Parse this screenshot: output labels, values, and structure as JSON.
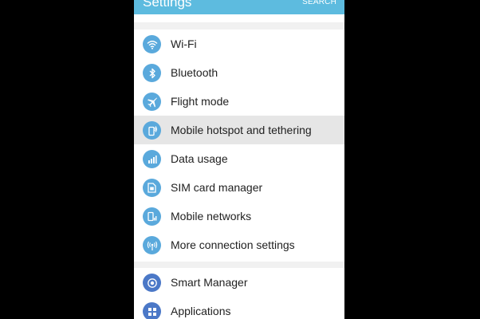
{
  "header": {
    "title": "Settings",
    "search_label": "SEARCH"
  },
  "colors": {
    "accent": "#5dbbdf",
    "icon_blue": "#5aa9dc",
    "icon_dark_blue": "#4b78c7",
    "highlight": "#e6e6e6"
  },
  "connections": {
    "items": [
      {
        "label": "Wi-Fi",
        "icon": "wifi-icon"
      },
      {
        "label": "Bluetooth",
        "icon": "bluetooth-icon"
      },
      {
        "label": "Flight mode",
        "icon": "airplane-icon"
      },
      {
        "label": "Mobile hotspot and tethering",
        "icon": "hotspot-icon",
        "highlighted": true
      },
      {
        "label": "Data usage",
        "icon": "data-usage-icon"
      },
      {
        "label": "SIM card manager",
        "icon": "sim-card-icon"
      },
      {
        "label": "Mobile networks",
        "icon": "mobile-network-icon"
      },
      {
        "label": "More connection settings",
        "icon": "more-connections-icon"
      }
    ]
  },
  "device": {
    "items": [
      {
        "label": "Smart Manager",
        "icon": "smart-manager-icon"
      },
      {
        "label": "Applications",
        "icon": "applications-icon"
      }
    ]
  }
}
